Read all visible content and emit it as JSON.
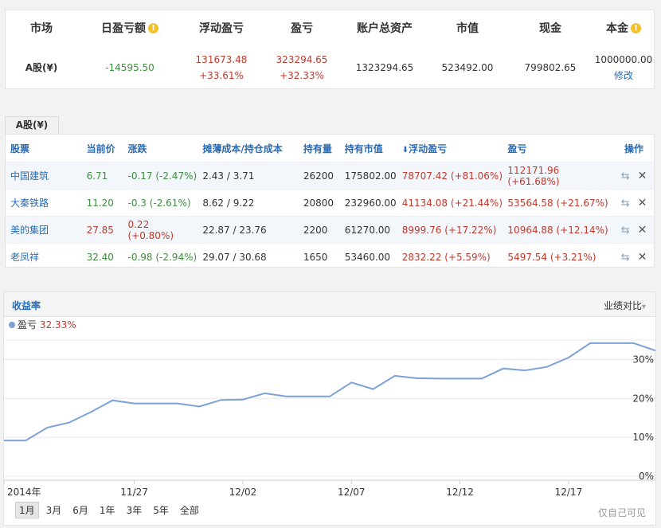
{
  "summary": {
    "headers": {
      "market": "市场",
      "daily_pl": "日盈亏额",
      "float_pl": "浮动盈亏",
      "pl": "盈亏",
      "total_assets": "账户总资产",
      "market_value": "市值",
      "cash": "现金",
      "principal": "本金"
    },
    "values": {
      "market": "A股(¥)",
      "daily_pl": "-14595.50",
      "float_pl": "131673.48",
      "float_pl_pct": "+33.61%",
      "pl": "323294.65",
      "pl_pct": "+32.33%",
      "total_assets": "1323294.65",
      "market_value": "523492.00",
      "cash": "799802.65",
      "principal": "1000000.00",
      "modify_link": "修改"
    }
  },
  "tabs": {
    "active": "A股(¥)"
  },
  "holdings": {
    "headers": {
      "stock": "股票",
      "price": "当前价",
      "change": "涨跌",
      "cost": "摊薄成本/持仓成本",
      "qty": "持有量",
      "mv": "持有市值",
      "float_pl": "浮动盈亏",
      "pl": "盈亏",
      "ops": "操作"
    },
    "sort_arrow": "⬇",
    "rows": [
      {
        "name": "中国建筑",
        "price": "6.71",
        "change": "-0.17 (-2.47%)",
        "cost": "2.43 / 3.71",
        "qty": "26200",
        "mv": "175802.00",
        "float_pl": "78707.42 (+81.06%)",
        "pl": "112171.96 (+61.68%)",
        "dir": "down"
      },
      {
        "name": "大秦铁路",
        "price": "11.20",
        "change": "-0.3 (-2.61%)",
        "cost": "8.62 / 9.22",
        "qty": "20800",
        "mv": "232960.00",
        "float_pl": "41134.08 (+21.44%)",
        "pl": "53564.58 (+21.67%)",
        "dir": "down"
      },
      {
        "name": "美的集团",
        "price": "27.85",
        "change": "0.22 (+0.80%)",
        "cost": "22.87 / 23.76",
        "qty": "2200",
        "mv": "61270.00",
        "float_pl": "8999.76 (+17.22%)",
        "pl": "10964.88 (+12.14%)",
        "dir": "up"
      },
      {
        "name": "老凤祥",
        "price": "32.40",
        "change": "-0.98 (-2.94%)",
        "cost": "29.07 / 30.68",
        "qty": "1650",
        "mv": "53460.00",
        "float_pl": "2832.22 (+5.59%)",
        "pl": "5497.54 (+3.21%)",
        "dir": "down"
      }
    ],
    "share_icon": "⇆",
    "delete_icon": "✕"
  },
  "chart": {
    "title": "收益率",
    "compare_label": "业绩对比",
    "compare_arrow": "▾",
    "legend_name": "盈亏",
    "legend_value": "32.33%",
    "ranges": [
      "1月",
      "3月",
      "6月",
      "1年",
      "3年",
      "5年",
      "全部"
    ],
    "active_range": "1月",
    "private_note": "仅自己可见"
  },
  "colors": {
    "up": "#c0392b",
    "down": "#3e8e3e",
    "accent": "#2a6cb5",
    "line": "#7ba2d6"
  },
  "chart_data": {
    "type": "line",
    "x_tick_labels": [
      "2014年",
      "11/27",
      "12/02",
      "12/07",
      "12/12",
      "12/17"
    ],
    "x_tick_index": [
      0,
      6,
      11,
      16,
      21,
      26
    ],
    "y_tick_labels": [
      "0%",
      "10%",
      "20%",
      "30%"
    ],
    "ylim": [
      0,
      35
    ],
    "series": [
      {
        "name": "盈亏",
        "values": [
          9.2,
          9.2,
          12.5,
          13.8,
          16.5,
          19.5,
          18.7,
          18.7,
          18.7,
          17.9,
          19.6,
          19.7,
          21.3,
          20.5,
          20.5,
          20.5,
          24.1,
          22.4,
          25.8,
          25.2,
          25.1,
          25.1,
          25.1,
          27.7,
          27.2,
          28.1,
          30.5,
          34.2,
          34.2,
          34.2,
          32.3
        ]
      }
    ],
    "grid": true,
    "legend": "top-left"
  }
}
